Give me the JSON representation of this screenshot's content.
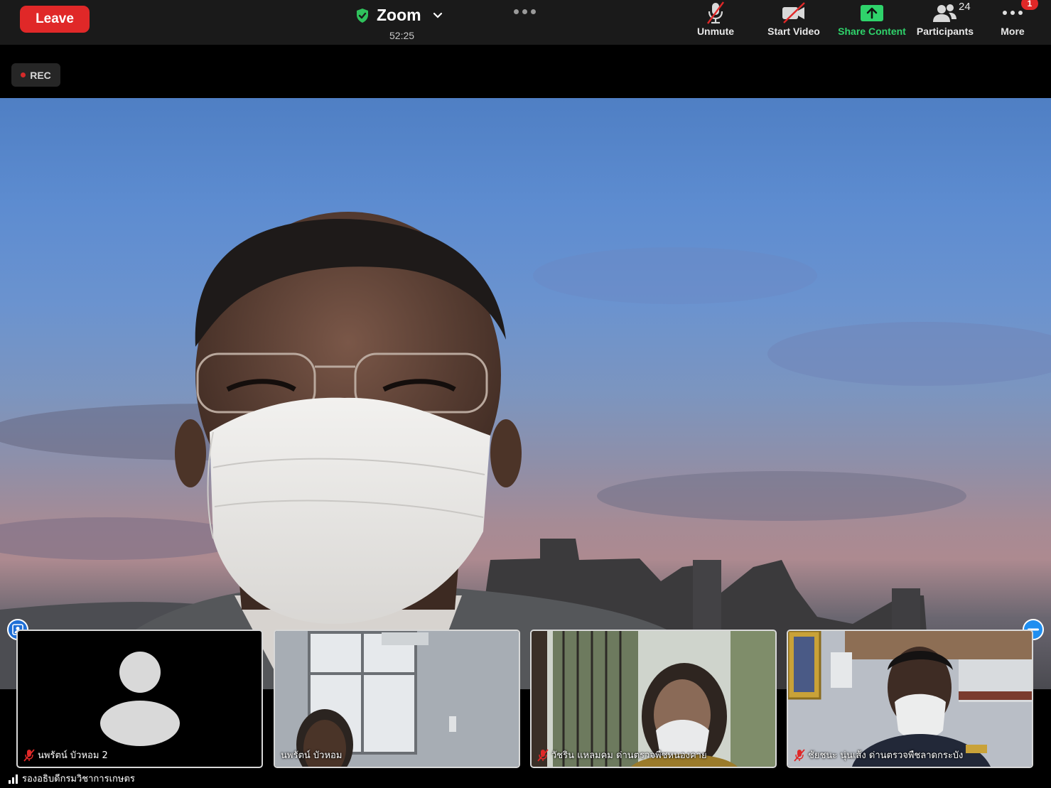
{
  "toolbar": {
    "leave_label": "Leave",
    "meeting_title": "Zoom",
    "timer": "52:25",
    "unmute_label": "Unmute",
    "start_video_label": "Start Video",
    "share_label": "Share Content",
    "participants_label": "Participants",
    "participants_count": "24",
    "more_label": "More",
    "more_badge": "1",
    "share_color": "#2fd36b",
    "leave_color": "#e02828"
  },
  "recording": {
    "label": "REC"
  },
  "thumbnails": [
    {
      "name": "นพรัตน์ บัวหอม 2",
      "muted": true,
      "video": false
    },
    {
      "name": "นพรัตน์ บัวหอม",
      "muted": false,
      "video": true
    },
    {
      "name": "วัชริน แหลมคม ด่านตรวจพืชหนองคาย",
      "muted": true,
      "video": true
    },
    {
      "name": "ชัยชนะ นุ่นเส้ง ด่านตรวจพืชลาดกระบัง",
      "muted": true,
      "video": true
    }
  ],
  "active_speaker": {
    "name": "รองอธิบดีกรมวิชาการเกษตร"
  },
  "icons": {
    "security": "shield-check-icon",
    "unmute": "mic-muted-icon",
    "video": "video-off-icon",
    "share": "share-arrow-icon",
    "participants": "people-icon",
    "more": "ellipsis-icon"
  }
}
